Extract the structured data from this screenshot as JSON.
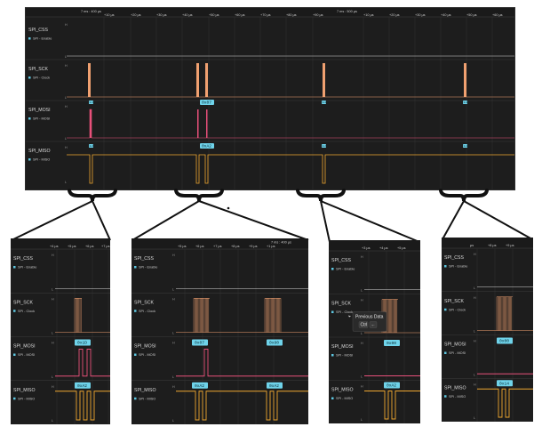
{
  "channels": [
    {
      "name": "SPI_CSS",
      "sub": "SPI - Enable",
      "color": "#d8d8d8"
    },
    {
      "name": "SPI_SCK",
      "sub": "SPI - Clock",
      "color": "#f0a070"
    },
    {
      "name": "SPI_MOSI",
      "sub": "SPI - MOSI",
      "color": "#e8507a"
    },
    {
      "name": "SPI_MISO",
      "sub": "SPI - MISO",
      "color": "#f0a830"
    }
  ],
  "colors": {
    "badge": "#6fd3ea",
    "dot": "#5ec6e0",
    "bg": "#1d1d1d"
  },
  "icons": [
    "color-dot-icon",
    "pointer-icon"
  ],
  "level_labels": {
    "high": "H",
    "low": "L"
  },
  "main": {
    "time_markers": [
      "7 ms : 400 µs",
      "7 ms : 500 µs"
    ],
    "ticks": [
      "+10 µs",
      "+20 µs",
      "+30 µs",
      "+40 µs",
      "+50 µs",
      "+60 µs",
      "+70 µs",
      "+80 µs",
      "+90 µs",
      "+10 µs",
      "+20 µs",
      "+30 µs",
      "+40 µs",
      "+50 µs",
      "+60 µs"
    ],
    "mosi_labels": [
      "0x1D",
      "0x07",
      "0x80",
      "0x00",
      "0x00"
    ],
    "miso_labels": [
      "0xA2",
      "0xA2",
      "0xA2",
      "0xA2",
      "0x14"
    ],
    "badge_value": "0x07",
    "badge_value_2": "0xA2"
  },
  "zooms": [
    {
      "ticks": [
        "+4 µs",
        "+5 µs",
        "+6 µs",
        "+7 µs"
      ],
      "mosi": [
        "0x1D"
      ],
      "miso": [
        "0xA2"
      ]
    },
    {
      "marker": "7 ms : 400 µs",
      "ticks": [
        "+5 µs",
        "+6 µs",
        "+7 µs",
        "+8 µs",
        "+9 µs",
        "+1 µs"
      ],
      "mosi": [
        "0x07",
        "0x80"
      ],
      "miso": [
        "0xA2",
        "0xA2"
      ]
    },
    {
      "ticks": [
        "+3 µs",
        "+4 µs",
        "+5 µs"
      ],
      "mosi": [
        "0x00"
      ],
      "miso": [
        "0xA2"
      ],
      "tooltip": {
        "title": "Previous Data",
        "key": "Ctrl",
        "arrow": "←"
      }
    },
    {
      "ticks": [
        "µs",
        "+8 µs",
        "+9 µs"
      ],
      "mosi": [
        "0x00"
      ],
      "miso": [
        "0x14"
      ]
    }
  ]
}
